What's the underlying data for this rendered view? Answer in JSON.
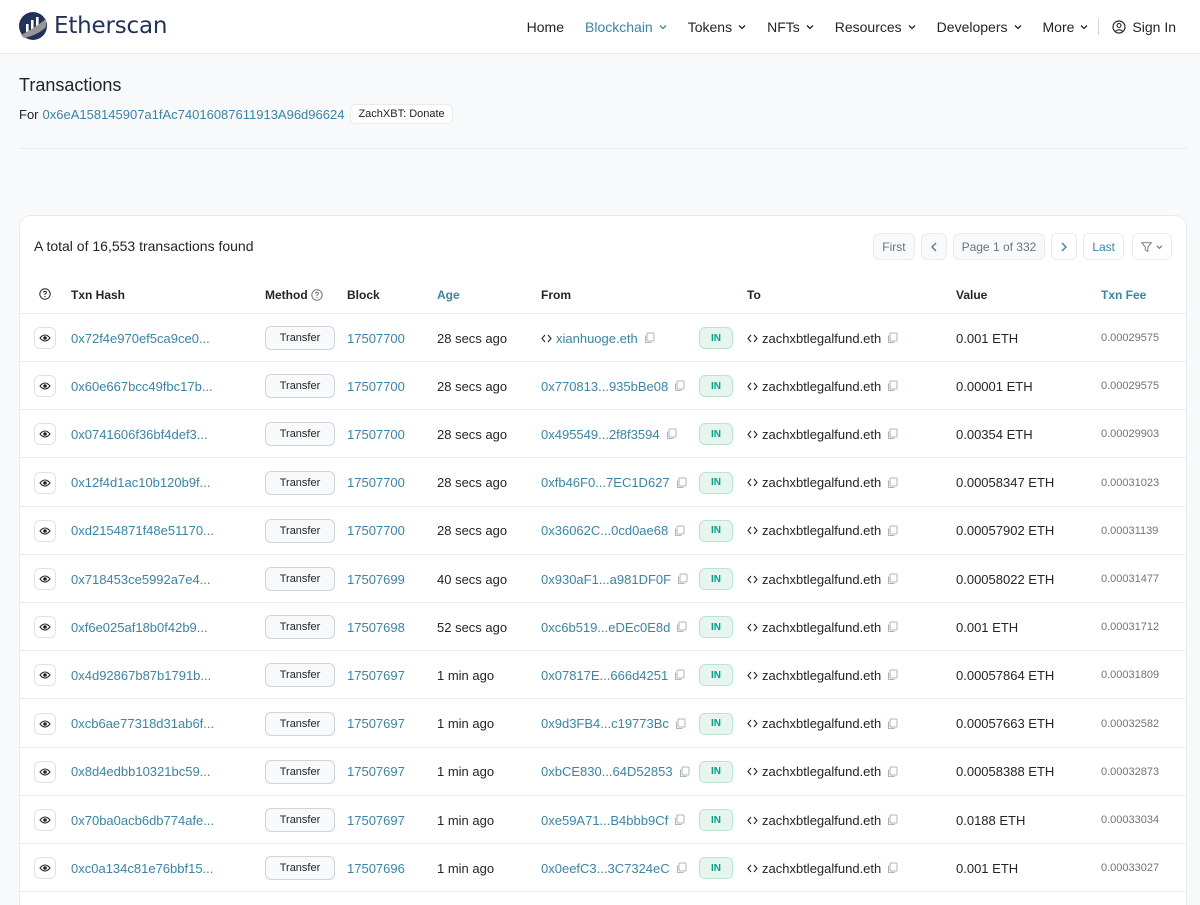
{
  "header": {
    "logo_text": "Etherscan",
    "nav": [
      {
        "label": "Home",
        "dropdown": false,
        "active": false
      },
      {
        "label": "Blockchain",
        "dropdown": true,
        "active": true
      },
      {
        "label": "Tokens",
        "dropdown": true,
        "active": false
      },
      {
        "label": "NFTs",
        "dropdown": true,
        "active": false
      },
      {
        "label": "Resources",
        "dropdown": true,
        "active": false
      },
      {
        "label": "Developers",
        "dropdown": true,
        "active": false
      },
      {
        "label": "More",
        "dropdown": true,
        "active": false
      }
    ],
    "sign_in": "Sign In"
  },
  "page": {
    "title": "Transactions",
    "for_label": "For",
    "address": "0x6eA158145907a1fAc74016087611913A96d96624",
    "name_tag": "ZachXBT: Donate"
  },
  "table": {
    "summary": "A total of 16,553 transactions found",
    "pager": {
      "first": "First",
      "page": "Page 1 of 332",
      "last": "Last"
    },
    "headers": {
      "txn_hash": "Txn Hash",
      "method": "Method",
      "block": "Block",
      "age": "Age",
      "from": "From",
      "to": "To",
      "value": "Value",
      "fee": "Txn Fee"
    },
    "rows": [
      {
        "hash": "0x72f4e970ef5ca9ce0...",
        "method": "Transfer",
        "block": "17507700",
        "age": "28 secs ago",
        "from": "xianhuoge.eth",
        "from_named": true,
        "direction": "IN",
        "to": "zachxbtlegalfund.eth",
        "value": "0.001 ETH",
        "fee": "0.00029575"
      },
      {
        "hash": "0x60e667bcc49fbc17b...",
        "method": "Transfer",
        "block": "17507700",
        "age": "28 secs ago",
        "from": "0x770813...935bBe08",
        "from_named": false,
        "direction": "IN",
        "to": "zachxbtlegalfund.eth",
        "value": "0.00001 ETH",
        "fee": "0.00029575"
      },
      {
        "hash": "0x0741606f36bf4def3...",
        "method": "Transfer",
        "block": "17507700",
        "age": "28 secs ago",
        "from": "0x495549...2f8f3594",
        "from_named": false,
        "direction": "IN",
        "to": "zachxbtlegalfund.eth",
        "value": "0.00354 ETH",
        "fee": "0.00029903"
      },
      {
        "hash": "0x12f4d1ac10b120b9f...",
        "method": "Transfer",
        "block": "17507700",
        "age": "28 secs ago",
        "from": "0xfb46F0...7EC1D627",
        "from_named": false,
        "direction": "IN",
        "to": "zachxbtlegalfund.eth",
        "value": "0.00058347 ETH",
        "fee": "0.00031023"
      },
      {
        "hash": "0xd2154871f48e51170...",
        "method": "Transfer",
        "block": "17507700",
        "age": "28 secs ago",
        "from": "0x36062C...0cd0ae68",
        "from_named": false,
        "direction": "IN",
        "to": "zachxbtlegalfund.eth",
        "value": "0.00057902 ETH",
        "fee": "0.00031139"
      },
      {
        "hash": "0x718453ce5992a7e4...",
        "method": "Transfer",
        "block": "17507699",
        "age": "40 secs ago",
        "from": "0x930aF1...a981DF0F",
        "from_named": false,
        "direction": "IN",
        "to": "zachxbtlegalfund.eth",
        "value": "0.00058022 ETH",
        "fee": "0.00031477"
      },
      {
        "hash": "0xf6e025af18b0f42b9...",
        "method": "Transfer",
        "block": "17507698",
        "age": "52 secs ago",
        "from": "0xc6b519...eDEc0E8d",
        "from_named": false,
        "direction": "IN",
        "to": "zachxbtlegalfund.eth",
        "value": "0.001 ETH",
        "fee": "0.00031712"
      },
      {
        "hash": "0x4d92867b87b1791b...",
        "method": "Transfer",
        "block": "17507697",
        "age": "1 min ago",
        "from": "0x07817E...666d4251",
        "from_named": false,
        "direction": "IN",
        "to": "zachxbtlegalfund.eth",
        "value": "0.00057864 ETH",
        "fee": "0.00031809"
      },
      {
        "hash": "0xcb6ae77318d31ab6f...",
        "method": "Transfer",
        "block": "17507697",
        "age": "1 min ago",
        "from": "0x9d3FB4...c19773Bc",
        "from_named": false,
        "direction": "IN",
        "to": "zachxbtlegalfund.eth",
        "value": "0.00057663 ETH",
        "fee": "0.00032582"
      },
      {
        "hash": "0x8d4edbb10321bc59...",
        "method": "Transfer",
        "block": "17507697",
        "age": "1 min ago",
        "from": "0xbCE830...64D52853",
        "from_named": false,
        "direction": "IN",
        "to": "zachxbtlegalfund.eth",
        "value": "0.00058388 ETH",
        "fee": "0.00032873"
      },
      {
        "hash": "0x70ba0acb6db774afe...",
        "method": "Transfer",
        "block": "17507697",
        "age": "1 min ago",
        "from": "0xe59A71...B4bbb9Cf",
        "from_named": false,
        "direction": "IN",
        "to": "zachxbtlegalfund.eth",
        "value": "0.0188 ETH",
        "fee": "0.00033034"
      },
      {
        "hash": "0xc0a134c81e76bbf15...",
        "method": "Transfer",
        "block": "17507696",
        "age": "1 min ago",
        "from": "0x0eefC3...3C7324eC",
        "from_named": false,
        "direction": "IN",
        "to": "zachxbtlegalfund.eth",
        "value": "0.001 ETH",
        "fee": "0.00033027"
      }
    ]
  }
}
